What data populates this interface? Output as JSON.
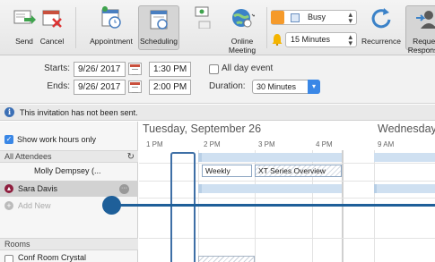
{
  "ribbon": {
    "send": "Send",
    "cancel": "Cancel",
    "appointment": "Appointment",
    "scheduling": "Scheduling",
    "online_meeting_l1": "Online",
    "online_meeting_l2": "Meeting",
    "show_as": "Busy",
    "reminder": "15 Minutes",
    "recurrence": "Recurrence",
    "request_l1": "Request",
    "request_l2": "Responses"
  },
  "dates": {
    "starts_label": "Starts:",
    "ends_label": "Ends:",
    "start_date": "9/26/ 2017",
    "start_time": "1:30 PM",
    "end_date": "9/26/ 2017",
    "end_time": "2:00 PM",
    "all_day_label": "All day event",
    "duration_label": "Duration:",
    "duration_value": "30 Minutes"
  },
  "infobar": {
    "text": "This invitation has not been sent."
  },
  "attendees": {
    "show_work_hours": "Show work hours only",
    "header": "All Attendees",
    "rows": [
      "Molly Dempsey (...",
      "Sara Davis"
    ],
    "add_new": "Add New",
    "rooms_header": "Rooms",
    "room": "Conf Room Crystal"
  },
  "timeline": {
    "day1": "Tuesday, September 26",
    "day2": "Wednesday",
    "hours": [
      "1 PM",
      "2 PM",
      "3 PM",
      "4 PM",
      "9 AM"
    ],
    "appointments": [
      "Weekly",
      "XT Series Overview"
    ]
  },
  "colors": {
    "accent": "#3a87e6",
    "selection": "#3e6fa6",
    "freebusy": "#cfe0f1",
    "organizer": "#8f1f3f"
  }
}
